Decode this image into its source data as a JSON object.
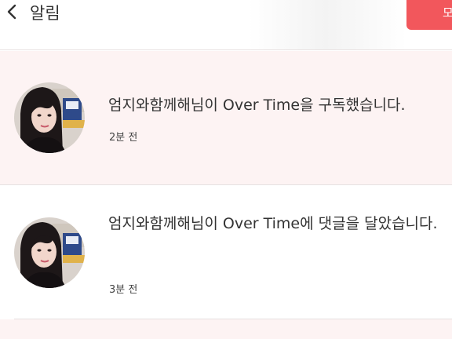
{
  "header": {
    "title": "알림",
    "action_label": "모"
  },
  "notifications": [
    {
      "message": "엄지와함께해님이 Over Time을 구독했습니다.",
      "time": "2분 전",
      "unread": true
    },
    {
      "message": "엄지와함께해님이 Over Time에 댓글을 달았습니다.",
      "time": "3분 전",
      "unread": false
    }
  ],
  "colors": {
    "accent": "#f2575c",
    "unread_background": "#fdf3f3",
    "divider": "#e6e0e0"
  },
  "icons": {
    "back": "chevron-left-icon",
    "avatar": "user-avatar-photo"
  }
}
